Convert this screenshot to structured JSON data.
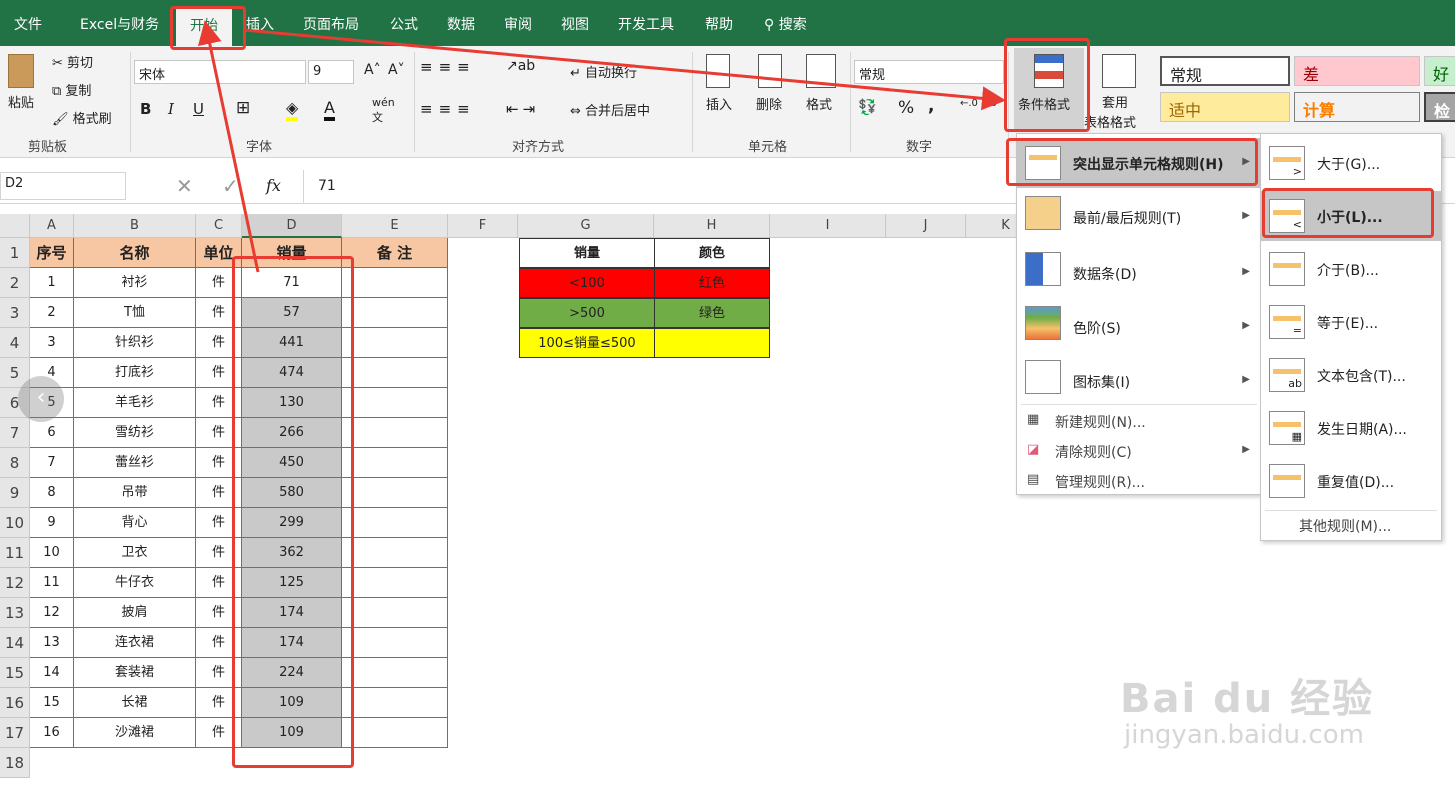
{
  "menu": {
    "tabs": [
      "文件",
      "Excel与财务",
      "开始",
      "插入",
      "页面布局",
      "公式",
      "数据",
      "审阅",
      "视图",
      "开发工具",
      "帮助"
    ],
    "search": "搜索"
  },
  "ribbon": {
    "clipboard": {
      "group": "剪贴板",
      "paste": "粘贴",
      "cut": "剪切",
      "copy": "复制",
      "format_painter": "格式刷"
    },
    "font": {
      "group": "字体",
      "font_name": "宋体",
      "font_size": "9",
      "bold": "B",
      "italic": "I",
      "underline": "U"
    },
    "align": {
      "group": "对齐方式",
      "wrap": "自动换行",
      "merge": "合并后居中"
    },
    "cells": {
      "group": "单元格",
      "insert": "插入",
      "delete": "删除",
      "format": "格式"
    },
    "number": {
      "group": "数字",
      "format": "常规",
      "percent": "%",
      "comma": ","
    },
    "styles": {
      "cf": "条件格式",
      "table_fmt_1": "套用",
      "table_fmt_2": "表格格式",
      "normal": "常规",
      "bad": "差",
      "good": "好",
      "neutral": "适中",
      "calc": "计算",
      "check": "检"
    }
  },
  "formula_bar": {
    "name_box": "D2",
    "fx": "fx",
    "value": "71"
  },
  "columns": [
    "A",
    "B",
    "C",
    "D",
    "E",
    "F",
    "G",
    "H",
    "I",
    "J",
    "K"
  ],
  "rows": [
    "1",
    "2",
    "3",
    "4",
    "5",
    "6",
    "7",
    "8",
    "9",
    "10",
    "11",
    "12",
    "13",
    "14",
    "15",
    "16",
    "17",
    "18"
  ],
  "table": {
    "headers": [
      "序号",
      "名称",
      "单位",
      "销量",
      "备  注"
    ],
    "data": [
      [
        "1",
        "衬衫",
        "件",
        "71"
      ],
      [
        "2",
        "T恤",
        "件",
        "57"
      ],
      [
        "3",
        "针织衫",
        "件",
        "441"
      ],
      [
        "4",
        "打底衫",
        "件",
        "474"
      ],
      [
        "5",
        "羊毛衫",
        "件",
        "130"
      ],
      [
        "6",
        "雪纺衫",
        "件",
        "266"
      ],
      [
        "7",
        "蕾丝衫",
        "件",
        "450"
      ],
      [
        "8",
        "吊带",
        "件",
        "580"
      ],
      [
        "9",
        "背心",
        "件",
        "299"
      ],
      [
        "10",
        "卫衣",
        "件",
        "362"
      ],
      [
        "11",
        "牛仔衣",
        "件",
        "125"
      ],
      [
        "12",
        "披肩",
        "件",
        "174"
      ],
      [
        "13",
        "连衣裙",
        "件",
        "174"
      ],
      [
        "14",
        "套装裙",
        "件",
        "224"
      ],
      [
        "15",
        "长裙",
        "件",
        "109"
      ],
      [
        "16",
        "沙滩裙",
        "件",
        "109"
      ]
    ]
  },
  "legend_table": {
    "h1": "销量",
    "h2": "颜色",
    "r1": [
      "<100",
      "红色"
    ],
    "r2": [
      ">500",
      "绿色"
    ],
    "r3": [
      "100≤销量≤500",
      ""
    ],
    "colors": {
      "red": "#ff0000",
      "green": "#70ad47",
      "yellow": "#ffff00"
    }
  },
  "cf_menu": {
    "items": [
      "突出显示单元格规则(H)",
      "最前/最后规则(T)",
      "数据条(D)",
      "色阶(S)",
      "图标集(I)"
    ],
    "actions": [
      "新建规则(N)...",
      "清除规则(C)",
      "管理规则(R)..."
    ]
  },
  "submenu": {
    "items": [
      "大于(G)...",
      "小于(L)...",
      "介于(B)...",
      "等于(E)...",
      "文本包含(T)...",
      "发生日期(A)...",
      "重复值(D)..."
    ],
    "more": "其他规则(M)..."
  },
  "watermark": {
    "brand": "Bai du 经验",
    "url": "jingyan.baidu.com"
  }
}
